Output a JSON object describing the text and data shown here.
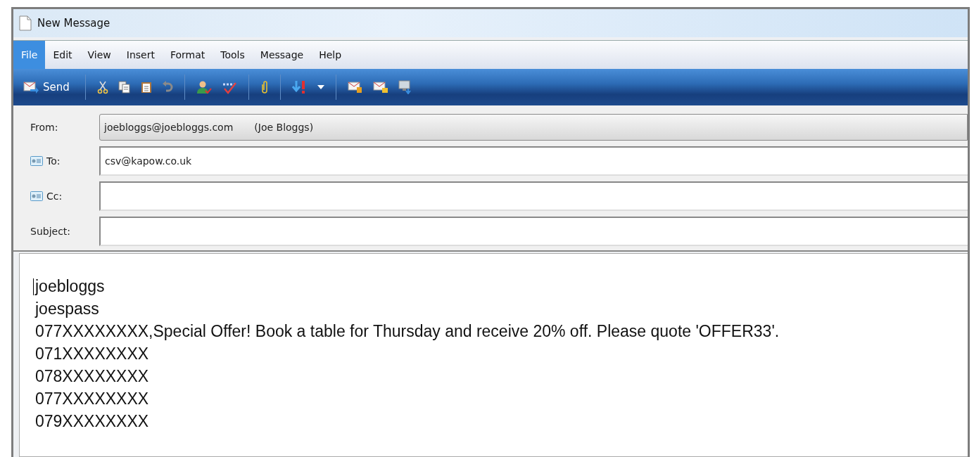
{
  "window": {
    "title": "New Message"
  },
  "menu": [
    {
      "label": "File",
      "selected": true
    },
    {
      "label": "Edit",
      "selected": false
    },
    {
      "label": "View",
      "selected": false
    },
    {
      "label": "Insert",
      "selected": false
    },
    {
      "label": "Format",
      "selected": false
    },
    {
      "label": "Tools",
      "selected": false
    },
    {
      "label": "Message",
      "selected": false
    },
    {
      "label": "Help",
      "selected": false
    }
  ],
  "toolbar": {
    "send_label": "Send"
  },
  "header_fields": [
    {
      "kind": "select",
      "label": "From:",
      "address_book": false,
      "value": "joebloggs@joebloggs.com",
      "name": "(Joe Bloggs)"
    },
    {
      "kind": "input",
      "label": "To:",
      "address_book": true,
      "value": "csv@kapow.co.uk"
    },
    {
      "kind": "input",
      "label": "Cc:",
      "address_book": true
    },
    {
      "kind": "input",
      "label": "Subject:",
      "address_book": false
    }
  ],
  "body_lines": [
    "joebloggs",
    "joespass",
    "077XXXXXXXX,Special Offer! Book a table for Thursday and receive 20% off. Please quote 'OFFER33'.",
    "071XXXXXXXX",
    "078XXXXXXXX",
    "077XXXXXXXX",
    "079XXXXXXXX"
  ]
}
